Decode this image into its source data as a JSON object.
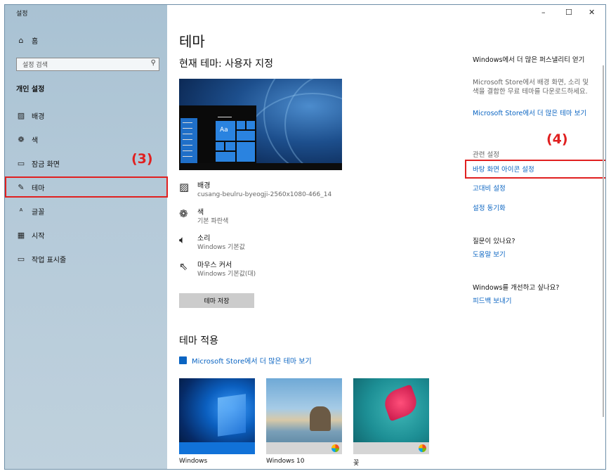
{
  "window": {
    "title": "설정",
    "controls": {
      "minimize": "–",
      "maximize": "☐",
      "close": "✕"
    }
  },
  "sidebar": {
    "home": "홈",
    "search_placeholder": "설정 검색",
    "section": "개인 설정",
    "items": [
      {
        "label": "배경",
        "icon": "image-icon"
      },
      {
        "label": "색",
        "icon": "palette-icon"
      },
      {
        "label": "잠금 화면",
        "icon": "lock-screen-icon"
      },
      {
        "label": "테마",
        "icon": "theme-icon"
      },
      {
        "label": "글꼴",
        "icon": "font-icon"
      },
      {
        "label": "시작",
        "icon": "start-icon"
      },
      {
        "label": "작업 표시줄",
        "icon": "taskbar-icon"
      }
    ]
  },
  "annotations": {
    "marker3": "(3)",
    "marker4": "(4)",
    "highlight_color": "#e02020"
  },
  "main": {
    "title": "테마",
    "current_theme": "현재 테마: 사용자 지정",
    "preview_text": "Aa",
    "properties": [
      {
        "name": "배경",
        "value": "cusang-beulru-byeogji-2560x1080-466_14",
        "icon": "image-icon"
      },
      {
        "name": "색",
        "value": "기본 파란색",
        "icon": "palette-icon"
      },
      {
        "name": "소리",
        "value": "Windows 기본값",
        "icon": "speaker-icon"
      },
      {
        "name": "마우스 커서",
        "value": "Windows 기본값(대)",
        "icon": "cursor-icon"
      }
    ],
    "save_button": "테마 저장",
    "apply_title": "테마 적용",
    "store_link": "Microsoft Store에서 더 많은 테마 보기",
    "themes": [
      {
        "name": "Windows"
      },
      {
        "name": "Windows 10"
      },
      {
        "name": "꽃"
      }
    ]
  },
  "right": {
    "store_heading": "Windows에서 더 많은 퍼스낼리티 얻기",
    "store_desc": "Microsoft Store에서 배경 화면, 소리 및 색을 결합한 무료 테마를 다운로드하세요.",
    "store_link": "Microsoft Store에서 더 많은 테마 보기",
    "related_heading": "관련 설정",
    "desktop_icons": "바탕 화면 아이콘 설정",
    "high_contrast": "고대비 설정",
    "sync": "설정 동기화",
    "question": "질문이 있나요?",
    "help": "도움말 보기",
    "improve": "Windows를 개선하고 싶나요?",
    "feedback": "피드백 보내기"
  },
  "colors": {
    "accent": "#0a64c2",
    "sidebar": "#b5cad9"
  }
}
